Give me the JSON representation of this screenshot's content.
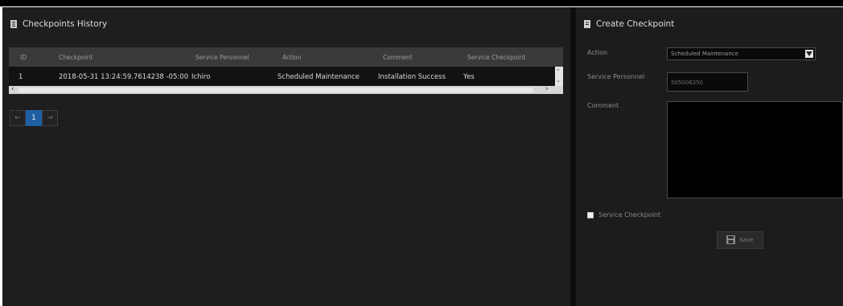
{
  "history": {
    "title": "Checkpoints History",
    "columns": [
      "ID",
      "Checkpoint",
      "Service Personnel",
      "Action",
      "Comment",
      "Service Checkpoint"
    ],
    "rows": [
      {
        "id": "1",
        "checkpoint": "2018-05-31 13:24:59.7614238 -05:00",
        "service_personnel": "Ichiro",
        "action": "Scheduled Maintenance",
        "comment": "Installation Success",
        "service_checkpoint": "Yes"
      }
    ],
    "pagination": {
      "prev_icon": "arrow-left",
      "current_page": "1",
      "next_icon": "arrow-right"
    }
  },
  "create": {
    "title": "Create Checkpoint",
    "action_label": "Action",
    "action_value": "Scheduled Maintenance",
    "personnel_label": "Service Personnel",
    "personnel_value": "505006250",
    "comment_label": "Comment",
    "comment_value": "",
    "service_checkpoint_label": "Service Checkpoint",
    "save_label": "Save"
  },
  "colors": {
    "panel_bg": "#1e1e1e",
    "header_bg": "#3a3a3a",
    "accent": "#1f5fa3"
  }
}
